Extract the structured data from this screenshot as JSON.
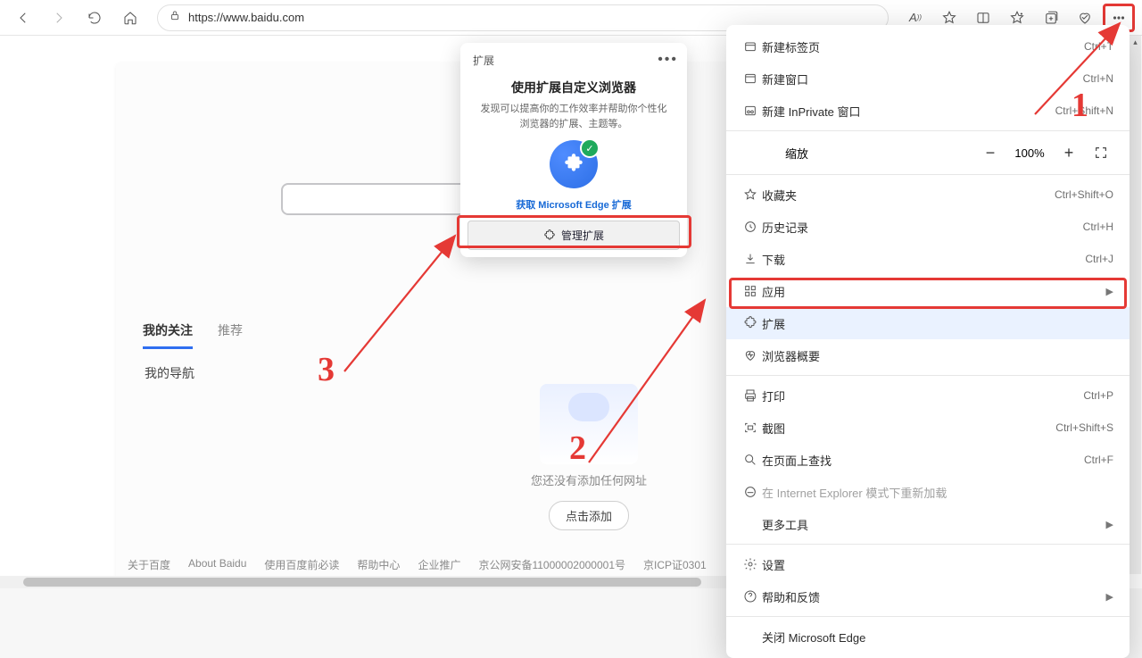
{
  "toolbar": {
    "url": "https://www.baidu.com"
  },
  "page": {
    "tabs": {
      "follow": "我的关注",
      "recommend": "推荐"
    },
    "nav_label": "我的导航",
    "empty_text": "您还没有添加任何网址",
    "add_btn": "点击添加",
    "footer": [
      "关于百度",
      "About Baidu",
      "使用百度前必读",
      "帮助中心",
      "企业推广",
      "京公网安备11000002000001号",
      "京ICP证0301"
    ]
  },
  "ext_popup": {
    "header": "扩展",
    "title": "使用扩展自定义浏览器",
    "desc": "发现可以提高你的工作效率并帮助你个性化浏览器的扩展、主题等。",
    "link": "获取 Microsoft Edge 扩展",
    "manage": "管理扩展"
  },
  "menu": {
    "new_tab": {
      "label": "新建标签页",
      "shortcut": "Ctrl+T"
    },
    "new_window": {
      "label": "新建窗口",
      "shortcut": "Ctrl+N"
    },
    "inprivate": {
      "label": "新建 InPrivate 窗口",
      "shortcut": "Ctrl+Shift+N"
    },
    "zoom": {
      "label": "缩放",
      "value": "100%"
    },
    "favorites": {
      "label": "收藏夹",
      "shortcut": "Ctrl+Shift+O"
    },
    "history": {
      "label": "历史记录",
      "shortcut": "Ctrl+H"
    },
    "downloads": {
      "label": "下载",
      "shortcut": "Ctrl+J"
    },
    "apps": {
      "label": "应用"
    },
    "extensions": {
      "label": "扩展"
    },
    "browser_essentials": {
      "label": "浏览器概要"
    },
    "print": {
      "label": "打印",
      "shortcut": "Ctrl+P"
    },
    "screenshot": {
      "label": "截图",
      "shortcut": "Ctrl+Shift+S"
    },
    "find": {
      "label": "在页面上查找",
      "shortcut": "Ctrl+F"
    },
    "ie_mode": {
      "label": "在 Internet Explorer 模式下重新加载"
    },
    "more_tools": {
      "label": "更多工具"
    },
    "settings": {
      "label": "设置"
    },
    "help": {
      "label": "帮助和反馈"
    },
    "close": {
      "label": "关闭 Microsoft Edge"
    }
  },
  "annotations": {
    "n1": "1",
    "n2": "2",
    "n3": "3"
  }
}
